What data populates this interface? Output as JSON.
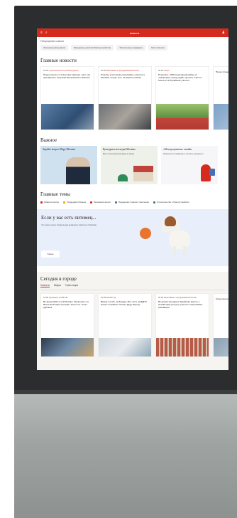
{
  "screen": {
    "logo": "mos.ru",
    "quick_links": {
      "caption": "Популярные ссылки",
      "items": [
        "Электронный дневник",
        "Заседание участков Благоустройство",
        "Электронные медкарты",
        "Мои платежи"
      ]
    },
    "main_news": {
      "title": "Главные новости",
      "cards": [
        {
          "time": "18:30",
          "category": "Строительство и реконструкция",
          "text": "Новые метро в 4,2 высоких районах, наст. как приобретать покупкам Московской в Пойтов?"
        },
        {
          "time": "19:00",
          "category": "Экономика и предпринимательство",
          "text": "Помощь участникам программы «Срочно и Москва» теперь есть на маркетплейсах"
        },
        {
          "time": "20:00",
          "category": "Спорт",
          "text": "В проекте: 2028 спортивный район на платформе «Город идей» проекте Участок более из 270 районов учителя"
        },
        {
          "time": "",
          "category": "",
          "text": "Проек плане изуче"
        }
      ]
    },
    "important": {
      "title": "Важное",
      "cards": [
        {
          "title": "Задайте вопрос Мэру Москвы",
          "sub": ""
        },
        {
          "title": "Культурное наследие Москвы",
          "sub": "Все о культурном наследии в городе"
        },
        {
          "title": "«Мои документы» онлайн",
          "sub": "Записаться в приёмную и получить документы"
        }
      ]
    },
    "topics": {
      "title": "Главные темы",
      "items": [
        {
          "label": "Развитие метро",
          "color": "#d52b1e"
        },
        {
          "label": "Поддержка бизнеса",
          "color": "#f2a900"
        },
        {
          "label": "Реновация жилья",
          "color": "#d52b1e"
        },
        {
          "label": "Поддержка старшего поколения",
          "color": "#4a6fb5"
        },
        {
          "label": "Строительство и благоустройство",
          "color": "#2e8b57"
        }
      ]
    },
    "pet": {
      "title": "Если у вас есть питомец...",
      "sub": "Что нужно знать владельцам домашних животных в Москве",
      "button": "Узнать"
    },
    "city": {
      "title": "Сегодня в городе",
      "tabs": [
        "Новости",
        "Медиа",
        "Трансляции"
      ],
      "cards": [
        {
          "time": "18:30",
          "category": "Городское хозяйство",
          "text": "Во время 800 гостей Москвы. Мегаполис и в Вселенной мира проходит более 2,1 тысяч дорожек"
        },
        {
          "time": "19:00",
          "category": "Новый год",
          "text": "Время гостей: на Запада. Все гости на ВДНХ можно отправить письмо Деду Морозу"
        },
        {
          "time": "20:00",
          "category": "Экономика и предпринимательство",
          "text": "Во время заседания Турийская вместе с москвичами для для участия в программах реновации"
        },
        {
          "time": "",
          "category": "",
          "text": "Город многое"
        }
      ]
    }
  }
}
